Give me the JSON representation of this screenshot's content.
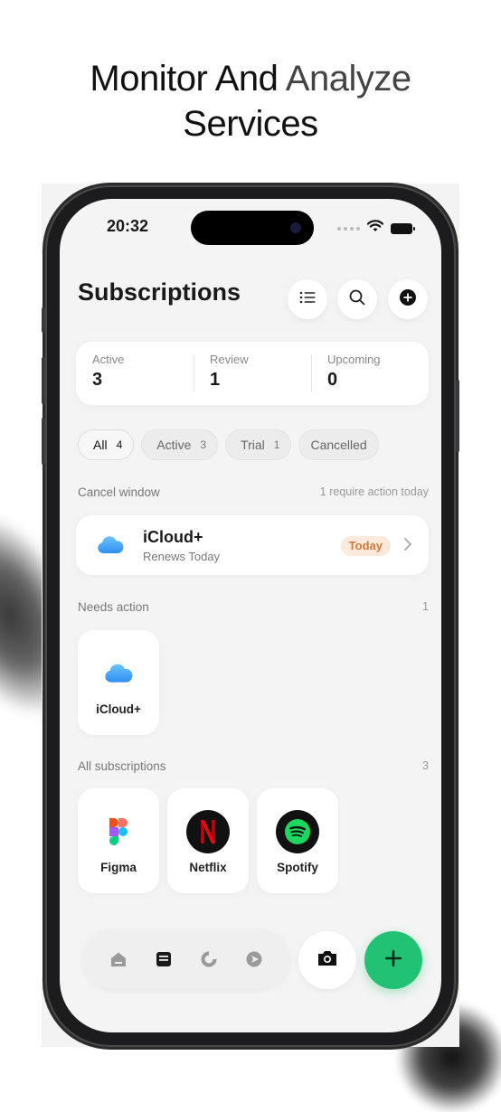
{
  "marketing": {
    "line1_dark": "Monitor And",
    "line1_light": "Analyze",
    "line2": "Services"
  },
  "status_bar": {
    "time": "20:32",
    "icons": [
      "cellular-dots-icon",
      "wifi-icon",
      "battery-icon"
    ]
  },
  "header": {
    "title": "Subscriptions",
    "actions": [
      "list-icon",
      "search-icon",
      "add-circle-icon"
    ]
  },
  "stats": [
    {
      "label": "Active",
      "value": "3"
    },
    {
      "label": "Review",
      "value": "1"
    },
    {
      "label": "Upcoming",
      "value": "0"
    }
  ],
  "filters": [
    {
      "label": "All",
      "count": "4",
      "selected": true
    },
    {
      "label": "Active",
      "count": "3",
      "selected": false
    },
    {
      "label": "Trial",
      "count": "1",
      "selected": false
    },
    {
      "label": "Cancelled",
      "count": "",
      "selected": false
    }
  ],
  "cancel_window": {
    "title": "Cancel window",
    "note": "1 require action today",
    "item": {
      "name": "iCloud+",
      "subtitle": "Renews Today",
      "badge": "Today",
      "icon": "icloud-icon"
    }
  },
  "needs_action": {
    "title": "Needs action",
    "count": "1",
    "items": [
      {
        "name": "iCloud+",
        "icon": "icloud-icon"
      }
    ]
  },
  "all_subscriptions": {
    "title": "All subscriptions",
    "count": "3",
    "items": [
      {
        "name": "Figma",
        "icon": "figma-icon"
      },
      {
        "name": "Netflix",
        "icon": "netflix-icon"
      },
      {
        "name": "Spotify",
        "icon": "spotify-icon"
      }
    ]
  },
  "tab_bar": {
    "items": [
      "home-icon",
      "subscriptions-icon",
      "analytics-icon",
      "explore-icon"
    ],
    "active": "subscriptions-icon",
    "camera": "camera-icon",
    "add": "plus-icon"
  },
  "colors": {
    "accent_green": "#22c274",
    "badge_bg": "#fbe9dc",
    "badge_text": "#d07a3a",
    "icloud_blue": "#4aa8f0",
    "netflix_red": "#e50914",
    "spotify_green": "#1ed760"
  }
}
